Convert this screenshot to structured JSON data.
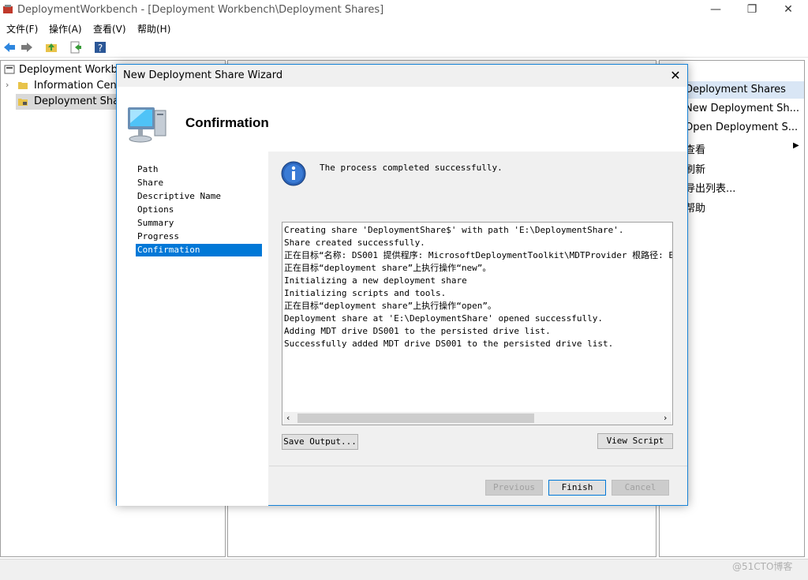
{
  "window": {
    "title": "DeploymentWorkbench - [Deployment Workbench\\Deployment Shares]",
    "minimize": "—",
    "maximize": "❐",
    "close": "✕"
  },
  "menu": {
    "file": "文件(F)",
    "action": "操作(A)",
    "view": "查看(V)",
    "help": "帮助(H)"
  },
  "tree": {
    "root": "Deployment Workbench",
    "info_center": "Information Center",
    "deployment_shares": "Deployment Shares"
  },
  "actions": {
    "header": "Deployment Shares",
    "items": [
      "New Deployment Sh...",
      "Open Deployment S...",
      "查看",
      "刷新",
      "导出列表...",
      "帮助"
    ]
  },
  "dialog": {
    "title": "New Deployment Share Wizard",
    "close": "✕",
    "heading": "Confirmation",
    "nav": [
      "Path",
      "Share",
      "Descriptive Name",
      "Options",
      "Summary",
      "Progress",
      "Confirmation"
    ],
    "selected_nav": "Confirmation",
    "info_message": "The process completed successfully.",
    "log_lines": [
      "Creating share 'DeploymentShare$' with path 'E:\\DeploymentShare'.",
      "Share created successfully.",
      "正在目标“名称: DS001 提供程序: MicrosoftDeploymentToolkit\\MDTProvider 根路径: E:\\",
      "正在目标“deployment share”上执行操作“new”。",
      "Initializing a new deployment share",
      "Initializing scripts and tools.",
      "正在目标“deployment share”上执行操作“open”。",
      "Deployment share at 'E:\\DeploymentShare' opened successfully.",
      "Adding MDT drive DS001 to the persisted drive list.",
      "Successfully added MDT drive DS001 to the persisted drive list."
    ],
    "buttons": {
      "save_output": "Save Output...",
      "view_script": "View Script",
      "previous": "Previous",
      "finish": "Finish",
      "cancel": "Cancel"
    }
  },
  "watermark": "@51CTO博客",
  "colors": {
    "accent": "#0078d7",
    "border": "#1883d7"
  }
}
